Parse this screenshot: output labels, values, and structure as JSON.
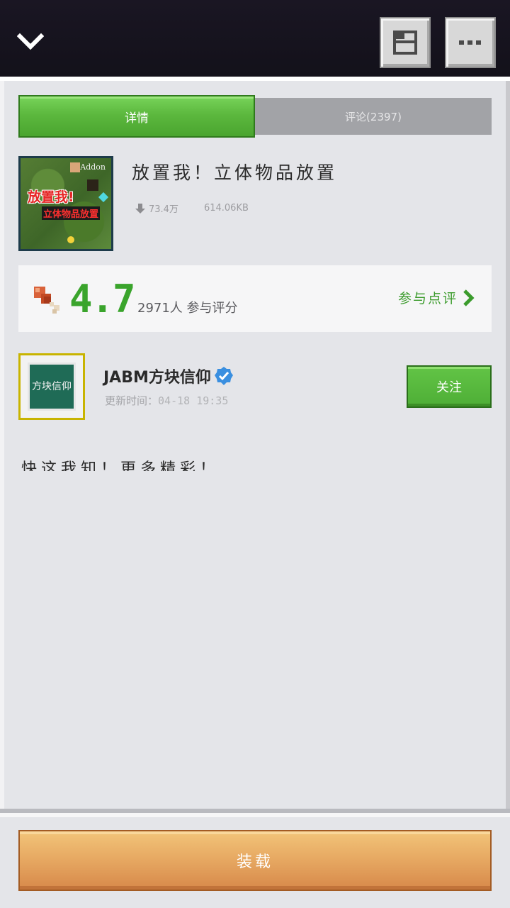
{
  "header": {
    "back_icon": "chevron-down-icon",
    "save_icon": "folder-save-icon",
    "more_icon": "more-dots-icon"
  },
  "tabs": [
    {
      "label": "详情",
      "active": true
    },
    {
      "label": "评论(2397)",
      "active": false
    }
  ],
  "addon": {
    "thumbnail_tag": "Addon",
    "thumbnail_line1": "放置我!",
    "thumbnail_line2": "立体物品放置",
    "title": "放置我！立体物品放置",
    "downloads": "73.4万",
    "size": "614.06KB"
  },
  "rating": {
    "score": "4.7",
    "count_text": "2971人 参与评分",
    "link_label": "参与点评"
  },
  "author": {
    "avatar_text": "方块信仰",
    "name": "JABM方块信仰",
    "update_label": "更新时间：",
    "update_time": "04-18 19:35",
    "follow_label": "关注"
  },
  "description": {
    "text": "快这我知！更多精彩！"
  },
  "footer": {
    "load_label": "装载"
  },
  "colors": {
    "accent_green": "#4aa52f",
    "load_orange": "#e6a761",
    "topbar": "#13111a"
  }
}
